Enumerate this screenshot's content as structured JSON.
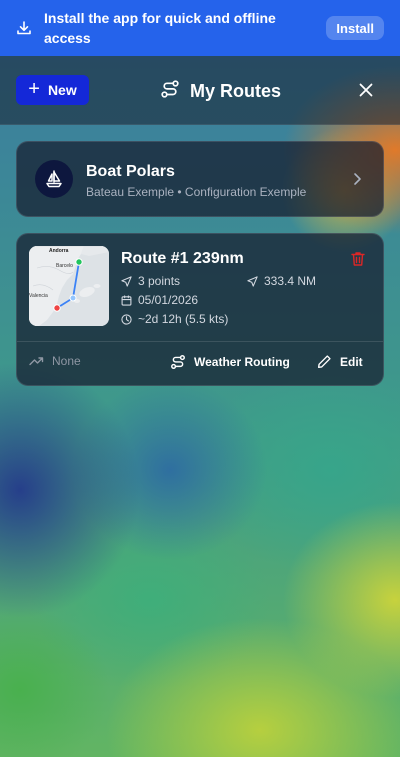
{
  "banner": {
    "message": "Install the app for quick and offline access",
    "install_label": "Install"
  },
  "header": {
    "new_label": "New",
    "title": "My Routes"
  },
  "polars": {
    "title": "Boat Polars",
    "subtitle": "Bateau Exemple • Configuration Exemple"
  },
  "route": {
    "title": "Route #1 239nm",
    "points": "3 points",
    "distance": "333.4 NM",
    "date": "05/01/2026",
    "duration": "~2d 12h (5.5 kts)",
    "map_labels": {
      "andorra": "Andorra",
      "barcelona": "Barcelo",
      "valencia": "Valencia"
    },
    "wind_label": "None",
    "weather_routing_label": "Weather Routing",
    "edit_label": "Edit"
  },
  "colors": {
    "banner": "#2563eb",
    "new_button": "#1428d8",
    "delete": "#dc2626",
    "start_marker": "#22c55e",
    "end_marker": "#ef4444",
    "route_line": "#3b82f6"
  }
}
